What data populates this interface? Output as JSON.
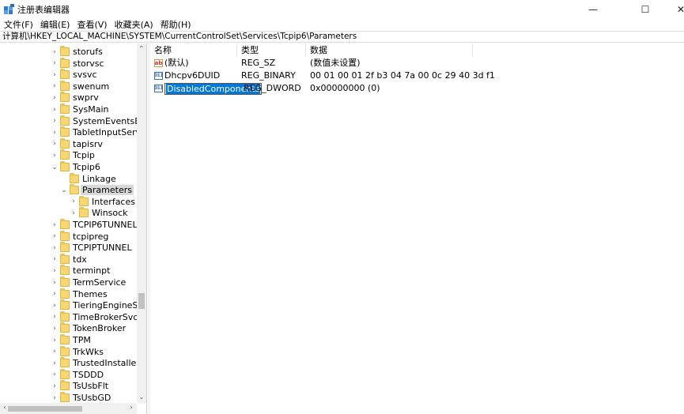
{
  "window": {
    "title": "注册表编辑器",
    "minimize_glyph": "—",
    "maximize_glyph": "☐",
    "close_glyph": "✕"
  },
  "menu": [
    "文件(F)",
    "编辑(E)",
    "查看(V)",
    "收藏夹(A)",
    "帮助(H)"
  ],
  "address": "计算机\\HKEY_LOCAL_MACHINE\\SYSTEM\\CurrentControlSet\\Services\\Tcpip6\\Parameters",
  "tree": {
    "items": [
      {
        "label": "storufs",
        "level": 0,
        "chevron": "›"
      },
      {
        "label": "storvsc",
        "level": 0,
        "chevron": "›"
      },
      {
        "label": "svsvc",
        "level": 0,
        "chevron": "›"
      },
      {
        "label": "swenum",
        "level": 0,
        "chevron": "›"
      },
      {
        "label": "swprv",
        "level": 0,
        "chevron": "›"
      },
      {
        "label": "SysMain",
        "level": 0,
        "chevron": "›"
      },
      {
        "label": "SystemEventsBroker",
        "level": 0,
        "chevron": "›"
      },
      {
        "label": "TabletInputService",
        "level": 0,
        "chevron": "›"
      },
      {
        "label": "tapisrv",
        "level": 0,
        "chevron": "›"
      },
      {
        "label": "Tcpip",
        "level": 0,
        "chevron": "›"
      },
      {
        "label": "Tcpip6",
        "level": 0,
        "chevron": "⌄"
      },
      {
        "label": "Linkage",
        "level": 1,
        "chevron": ""
      },
      {
        "label": "Parameters",
        "level": 1,
        "chevron": "⌄",
        "selected": true
      },
      {
        "label": "Interfaces",
        "level": 2,
        "chevron": "›"
      },
      {
        "label": "Winsock",
        "level": 2,
        "chevron": "›"
      },
      {
        "label": "TCPIP6TUNNEL",
        "level": 0,
        "chevron": "›"
      },
      {
        "label": "tcpipreg",
        "level": 0,
        "chevron": "›"
      },
      {
        "label": "TCPIPTUNNEL",
        "level": 0,
        "chevron": "›"
      },
      {
        "label": "tdx",
        "level": 0,
        "chevron": "›"
      },
      {
        "label": "terminpt",
        "level": 0,
        "chevron": "›"
      },
      {
        "label": "TermService",
        "level": 0,
        "chevron": "›"
      },
      {
        "label": "Themes",
        "level": 0,
        "chevron": "›"
      },
      {
        "label": "TieringEngineService",
        "level": 0,
        "chevron": "›"
      },
      {
        "label": "TimeBrokerSvc",
        "level": 0,
        "chevron": "›"
      },
      {
        "label": "TokenBroker",
        "level": 0,
        "chevron": "›"
      },
      {
        "label": "TPM",
        "level": 0,
        "chevron": "›"
      },
      {
        "label": "TrkWks",
        "level": 0,
        "chevron": "›"
      },
      {
        "label": "TrustedInstaller",
        "level": 0,
        "chevron": "›"
      },
      {
        "label": "TSDDD",
        "level": 0,
        "chevron": "›"
      },
      {
        "label": "TsUsbFlt",
        "level": 0,
        "chevron": "›"
      },
      {
        "label": "TsUsbGD",
        "level": 0,
        "chevron": "›"
      }
    ]
  },
  "list": {
    "headers": [
      "名称",
      "类型",
      "数据"
    ],
    "rows": [
      {
        "name": "(默认)",
        "type": "REG_SZ",
        "data": "(数值未设置)",
        "icon": "string-value-icon",
        "glyph": "ab"
      },
      {
        "name": "Dhcpv6DUID",
        "type": "REG_BINARY",
        "data": "00 01 00 01 2f b3 04 7a 00 0c 29 40 3d f1",
        "icon": "binary-value-icon",
        "glyph": "011"
      },
      {
        "name": "DisabledComponents",
        "type": "REG_DWORD",
        "data": "0x00000000 (0)",
        "icon": "binary-value-icon",
        "glyph": "011",
        "editing": true
      }
    ]
  },
  "colors": {
    "selection": "#0078d7",
    "folder": "#f7d774"
  }
}
